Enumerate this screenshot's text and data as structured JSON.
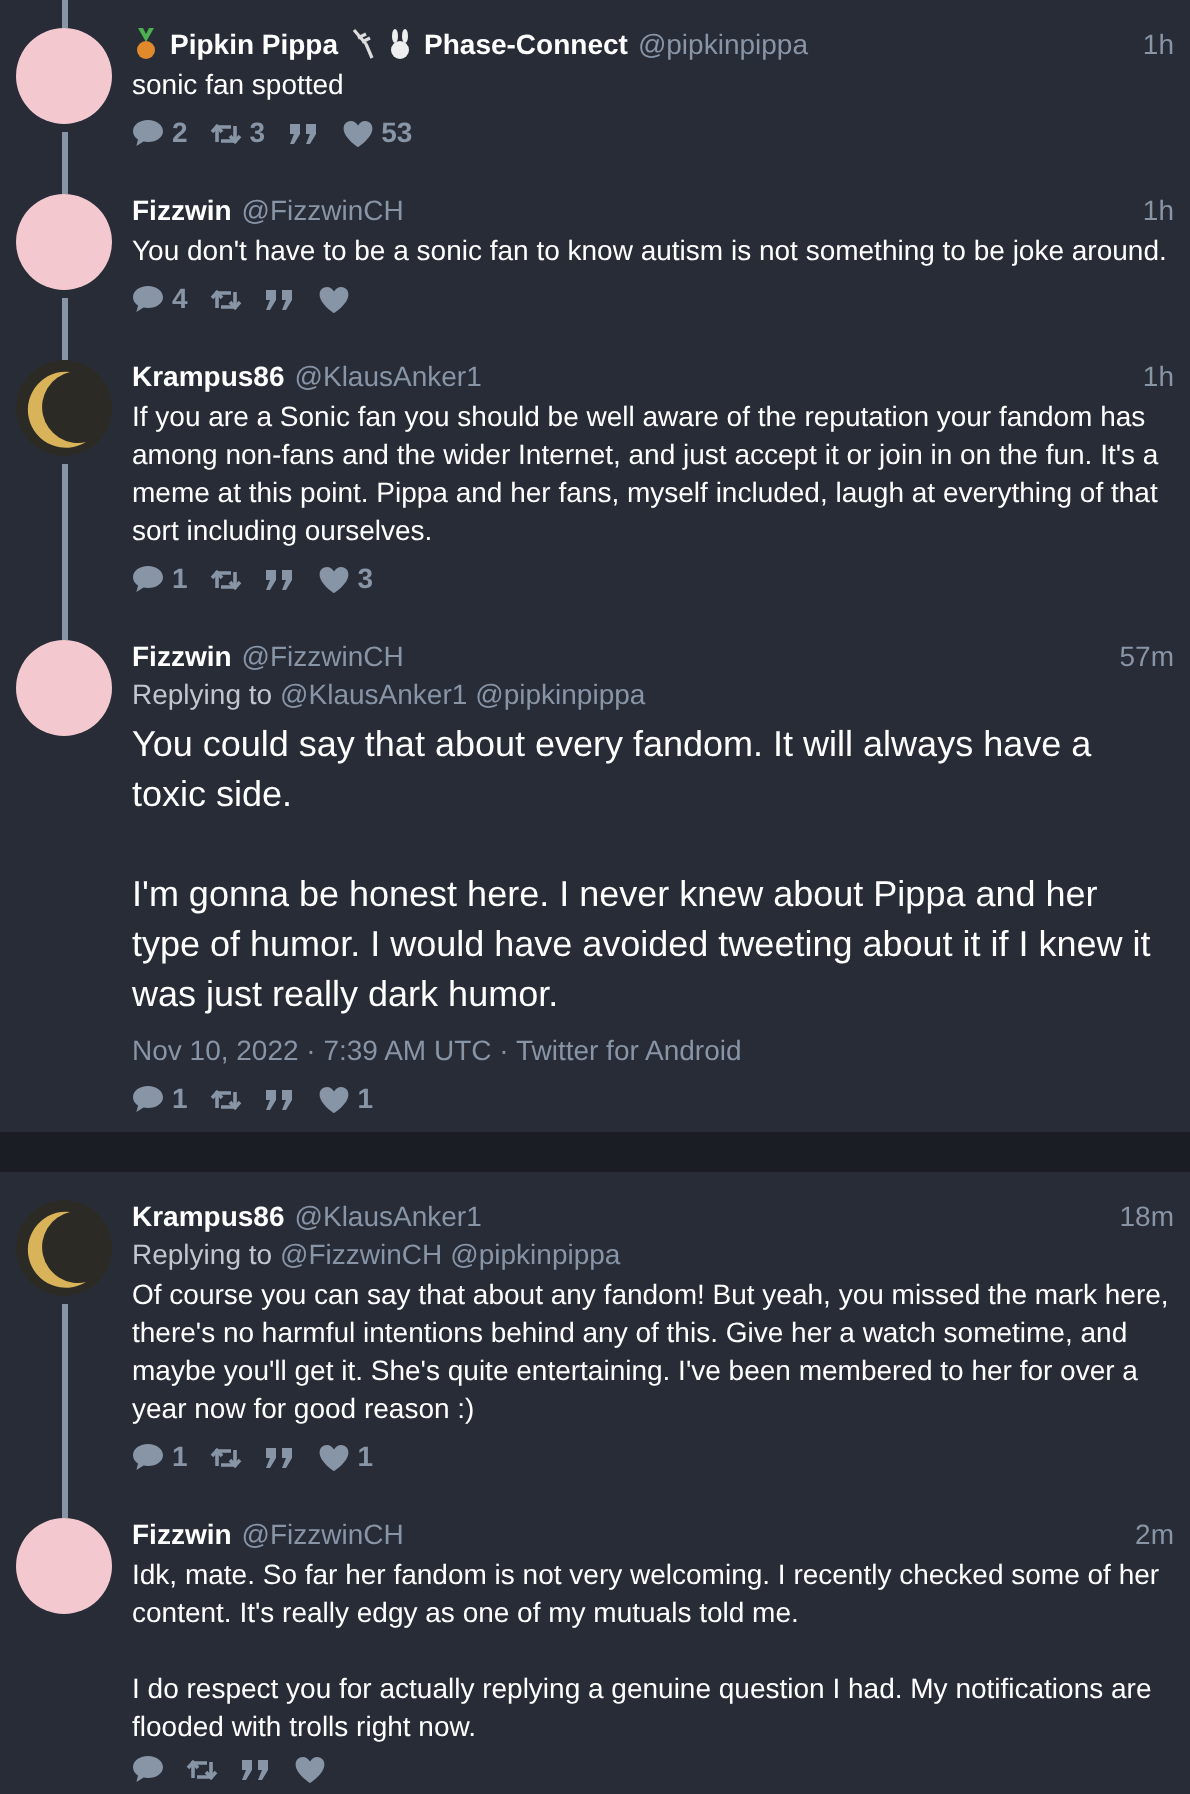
{
  "sections": [
    {
      "tweets": [
        {
          "kind": "reply",
          "avatar": {
            "kind": "pink"
          },
          "name": "Pipkin Pippa",
          "affiliation": "Phase-Connect",
          "handle": "@pipkinpippa",
          "time": "1h",
          "text": "sonic fan spotted",
          "thread_above": true,
          "thread_below": true,
          "stats": {
            "replies": "2",
            "retweets": "3",
            "likes": "53"
          }
        },
        {
          "kind": "reply",
          "avatar": {
            "kind": "pink"
          },
          "name": "Fizzwin",
          "handle": "@FizzwinCH",
          "time": "1h",
          "text": "You don't have to be a sonic fan to know autism is not something to be joke around.",
          "thread_above": true,
          "thread_below": true,
          "stats": {
            "replies": "4"
          }
        },
        {
          "kind": "reply",
          "avatar": {
            "kind": "moon"
          },
          "name": "Krampus86",
          "handle": "@KlausAnker1",
          "time": "1h",
          "text": "If you are a Sonic fan you should be well aware of the reputation your fandom has among non-fans and the wider Internet, and just accept it or join in on the fun. It's a meme at this point. Pippa and her fans, myself included, laugh at everything of that sort including ourselves.",
          "thread_above": true,
          "thread_below": true,
          "stats": {
            "replies": "1",
            "likes": "3"
          }
        },
        {
          "kind": "main",
          "avatar": {
            "kind": "pink"
          },
          "name": "Fizzwin",
          "handle": "@FizzwinCH",
          "time": "57m",
          "replying_label": "Replying to",
          "replying_to": [
            "@KlausAnker1",
            "@pipkinpippa"
          ],
          "text": "You could say that about every fandom. It will always have a toxic side.\n\nI'm gonna be honest here. I never knew about Pippa and her type of humor. I would have avoided tweeting about it if I knew it was just really dark humor.",
          "date": "Nov 10, 2022 · 7:39 AM UTC · Twitter for Android",
          "thread_above": true,
          "thread_below": false,
          "stats": {
            "replies": "1",
            "likes": "1"
          }
        }
      ]
    },
    {
      "tweets": [
        {
          "kind": "reply",
          "avatar": {
            "kind": "moon"
          },
          "name": "Krampus86",
          "handle": "@KlausAnker1",
          "time": "18m",
          "replying_label": "Replying to",
          "replying_to": [
            "@FizzwinCH",
            "@pipkinpippa"
          ],
          "text": "Of course you can say that about any fandom! But yeah, you missed the mark here, there's no harmful intentions behind any of this. Give her a watch sometime, and maybe you'll get it. She's quite entertaining. I've been membered to her for over a year now for good reason :)",
          "thread_above": false,
          "thread_below": true,
          "stats": {
            "replies": "1",
            "likes": "1"
          }
        },
        {
          "kind": "reply",
          "avatar": {
            "kind": "pink"
          },
          "name": "Fizzwin",
          "handle": "@FizzwinCH",
          "time": "2m",
          "text": "Idk, mate. So far her fandom is not very welcoming. I recently checked some of her content. It's really edgy as one of my mutuals told me.\n\nI do respect you for actually replying a genuine question I had. My notifications are flooded with trolls right now.",
          "thread_above": true,
          "thread_below": false
        }
      ]
    }
  ]
}
